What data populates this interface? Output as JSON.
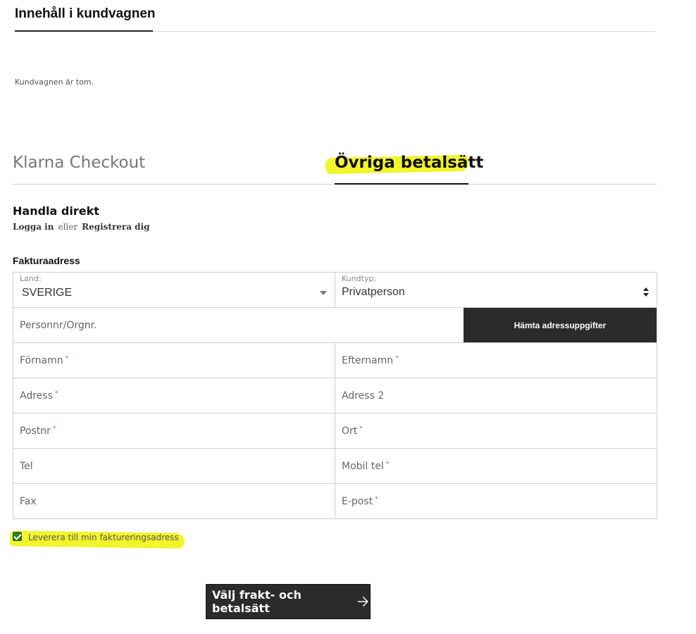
{
  "cart": {
    "title": "Innehåll i kundvagnen",
    "empty_text": "Kundvagnen är tom."
  },
  "tabs": [
    {
      "label": "Klarna Checkout",
      "active": false
    },
    {
      "label": "Övriga betalsätt",
      "active": true
    }
  ],
  "shop": {
    "title": "Handla direkt",
    "login_label": "Logga in",
    "or_label": "eller",
    "register_label": "Registrera dig"
  },
  "billing": {
    "title": "Fakturaadress",
    "country": {
      "label": "Land:",
      "value": "SVERIGE"
    },
    "customer_type": {
      "label": "Kundtyp:",
      "value": "Privatperson"
    },
    "personal_number_placeholder": "Personnr/Orgnr.",
    "fetch_button": "Hämta adressuppgifter",
    "fields": {
      "firstname": "Förnamn",
      "lastname": "Efternamn",
      "address": "Adress",
      "address2": "Adress 2",
      "postcode": "Postnr",
      "city": "Ort",
      "phone": "Tel",
      "mobile": "Mobil tel",
      "fax": "Fax",
      "email": "E-post"
    },
    "required_mark": "*"
  },
  "delivery": {
    "same_address_label": "Leverera till min faktureringsadress",
    "checked": true
  },
  "submit": {
    "label": "Välj frakt- och betalsätt"
  },
  "colors": {
    "highlight": "#f2f52a",
    "button_bg": "#2b2b2b",
    "required": "#d9534f",
    "checkbox": "#2f7a2f"
  }
}
